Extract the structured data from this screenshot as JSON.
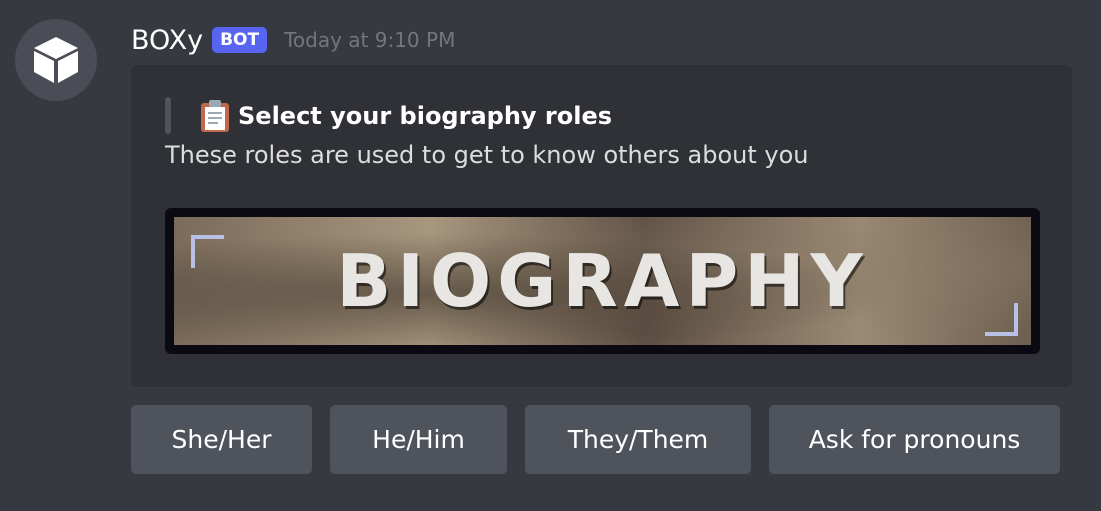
{
  "message": {
    "author": "BOXy",
    "badge": "BOT",
    "timestamp": "Today at 9:10 PM",
    "avatar_icon": "cube-icon"
  },
  "embed": {
    "title_emoji": "clipboard-icon",
    "title": "Select your biography roles",
    "description": "These roles are used to get to know others about you",
    "image_text": "BIOGRAPHY"
  },
  "buttons": [
    {
      "label": "She/Her"
    },
    {
      "label": "He/Him"
    },
    {
      "label": "They/Them"
    },
    {
      "label": "Ask for pronouns"
    }
  ],
  "colors": {
    "background": "#36393f",
    "embed_background": "#2f3136",
    "bot_badge": "#5865f2",
    "button": "#4f545c"
  }
}
